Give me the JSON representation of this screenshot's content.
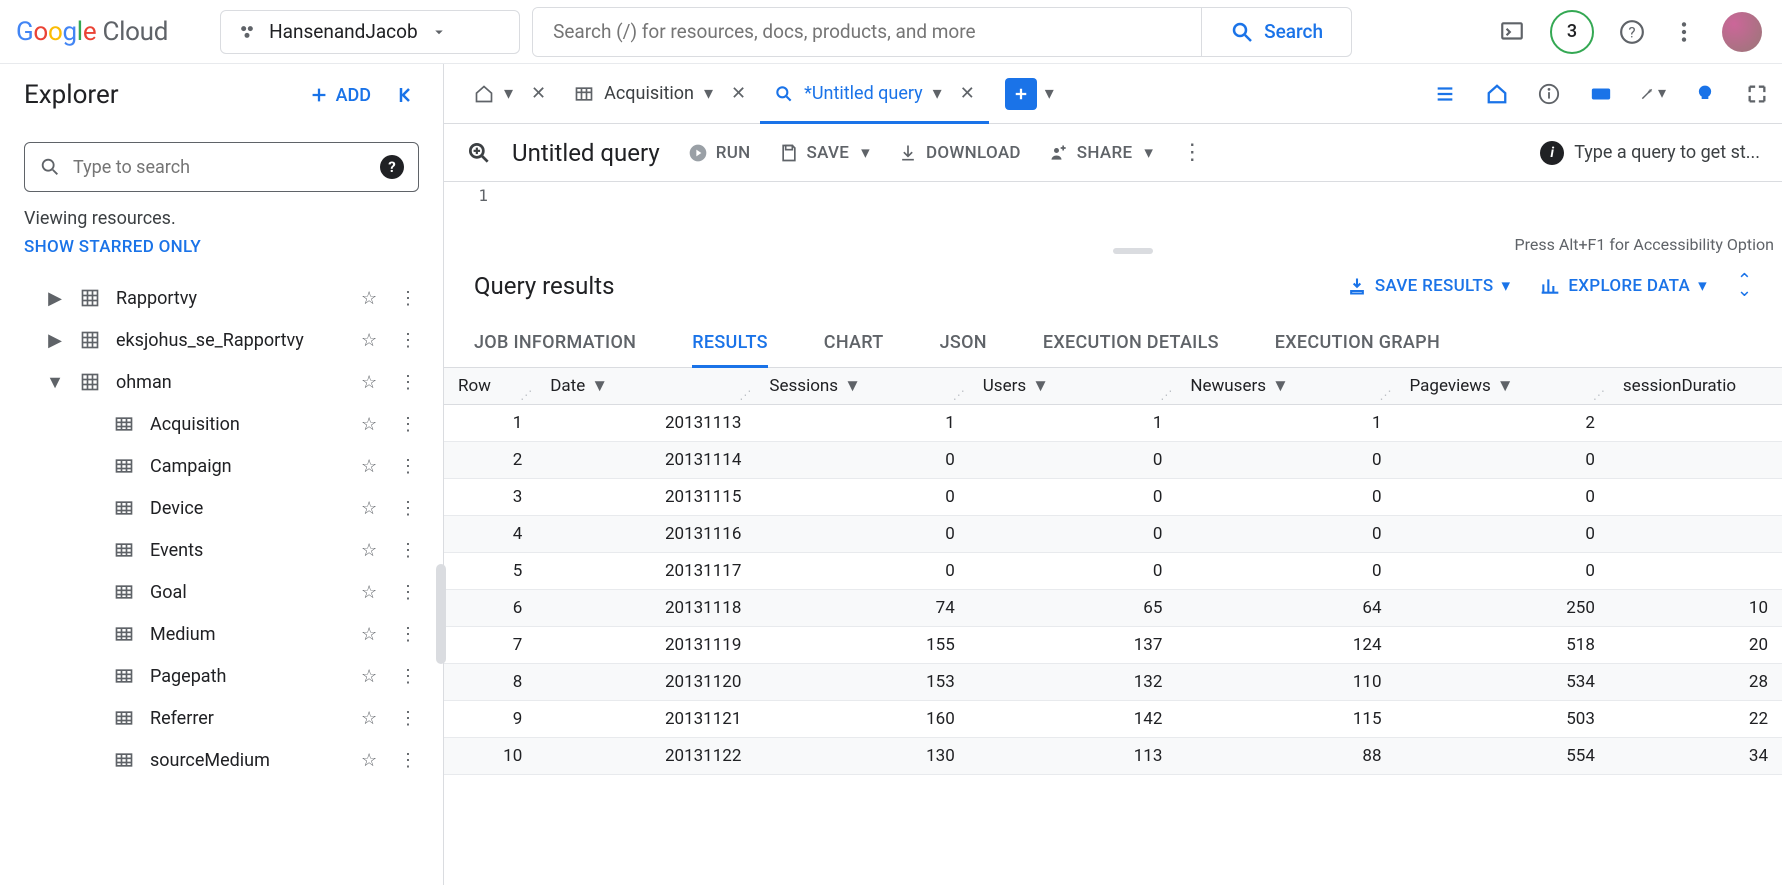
{
  "header": {
    "logo_text": "Google Cloud",
    "project_name": "HansenandJacob",
    "search_placeholder": "Search (/) for resources, docs, products, and more",
    "search_button": "Search",
    "badge_count": "3"
  },
  "explorer": {
    "title": "Explorer",
    "add_label": "ADD",
    "search_placeholder": "Type to search",
    "viewing_text": "Viewing resources.",
    "show_starred": "SHOW STARRED ONLY",
    "datasets": [
      {
        "label": "Rapportvy",
        "expanded": false
      },
      {
        "label": "eksjohus_se_Rapportvy",
        "expanded": false
      },
      {
        "label": "ohman",
        "expanded": true
      }
    ],
    "tables": [
      {
        "label": "Acquisition"
      },
      {
        "label": "Campaign"
      },
      {
        "label": "Device"
      },
      {
        "label": "Events"
      },
      {
        "label": "Goal"
      },
      {
        "label": "Medium"
      },
      {
        "label": "Pagepath"
      },
      {
        "label": "Referrer"
      },
      {
        "label": "sourceMedium"
      }
    ]
  },
  "tabs": {
    "items": [
      {
        "label": "",
        "icon": "home"
      },
      {
        "label": "Acquisition",
        "icon": "table"
      },
      {
        "label": "*Untitled query",
        "icon": "query",
        "active": true
      }
    ]
  },
  "queryBar": {
    "title": "Untitled query",
    "run": "RUN",
    "save": "SAVE",
    "download": "DOWNLOAD",
    "share": "SHARE",
    "tip": "Type a query to get st..."
  },
  "editor": {
    "line": "1",
    "accessibility": "Press Alt+F1 for Accessibility Option"
  },
  "resultsBar": {
    "title": "Query results",
    "save_results": "SAVE RESULTS",
    "explore_data": "EXPLORE DATA"
  },
  "resultTabs": [
    "JOB INFORMATION",
    "RESULTS",
    "CHART",
    "JSON",
    "EXECUTION DETAILS",
    "EXECUTION GRAPH"
  ],
  "table": {
    "columns": [
      "Row",
      "Date",
      "Sessions",
      "Users",
      "Newusers",
      "Pageviews",
      "sessionDuratio"
    ],
    "rows": [
      {
        "row": "1",
        "date": "20131113",
        "sessions": "1",
        "users": "1",
        "newusers": "1",
        "pageviews": "2",
        "dur": ""
      },
      {
        "row": "2",
        "date": "20131114",
        "sessions": "0",
        "users": "0",
        "newusers": "0",
        "pageviews": "0",
        "dur": ""
      },
      {
        "row": "3",
        "date": "20131115",
        "sessions": "0",
        "users": "0",
        "newusers": "0",
        "pageviews": "0",
        "dur": ""
      },
      {
        "row": "4",
        "date": "20131116",
        "sessions": "0",
        "users": "0",
        "newusers": "0",
        "pageviews": "0",
        "dur": ""
      },
      {
        "row": "5",
        "date": "20131117",
        "sessions": "0",
        "users": "0",
        "newusers": "0",
        "pageviews": "0",
        "dur": ""
      },
      {
        "row": "6",
        "date": "20131118",
        "sessions": "74",
        "users": "65",
        "newusers": "64",
        "pageviews": "250",
        "dur": "10"
      },
      {
        "row": "7",
        "date": "20131119",
        "sessions": "155",
        "users": "137",
        "newusers": "124",
        "pageviews": "518",
        "dur": "20"
      },
      {
        "row": "8",
        "date": "20131120",
        "sessions": "153",
        "users": "132",
        "newusers": "110",
        "pageviews": "534",
        "dur": "28"
      },
      {
        "row": "9",
        "date": "20131121",
        "sessions": "160",
        "users": "142",
        "newusers": "115",
        "pageviews": "503",
        "dur": "22"
      },
      {
        "row": "10",
        "date": "20131122",
        "sessions": "130",
        "users": "113",
        "newusers": "88",
        "pageviews": "554",
        "dur": "34"
      }
    ]
  }
}
